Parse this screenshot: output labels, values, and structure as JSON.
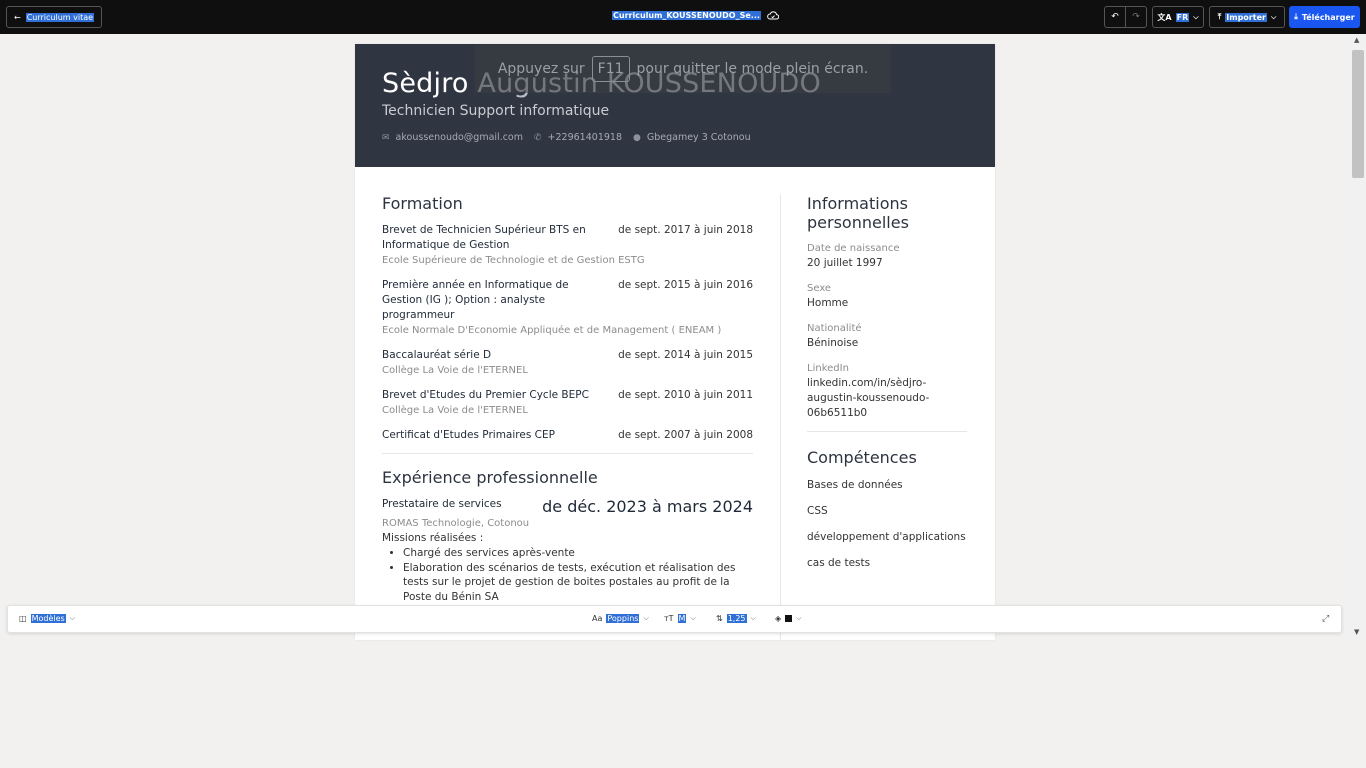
{
  "topbar": {
    "back_label": "Curriculum vitae",
    "doc_title": "Curriculum_KOUSSENOUDO_Se...",
    "undo_icon": "undo-icon",
    "redo_icon": "redo-icon",
    "language": "FR",
    "import_label": "Importer",
    "download_label": "Télécharger",
    "accent_color": "#1a56f0"
  },
  "overlay": {
    "before": "Appuyez sur",
    "key": "F11",
    "after": "pour quitter le mode plein écran."
  },
  "cv": {
    "first_name": "Sèdjro",
    "last_name": "Augustin KOUSSENOUDO",
    "role": "Technicien Support informatique",
    "email": "akoussenoudo@gmail.com",
    "phone": "+22961401918",
    "address": "Gbegamey 3 Cotonou",
    "header_color": "#2f3541",
    "education_title": "Formation",
    "education": [
      {
        "degree": "Brevet de Technicien Supérieur BTS en Informatique de Gestion",
        "school": "Ecole Supérieure de Technologie et de Gestion ESTG",
        "dates": "de sept. 2017 à juin 2018"
      },
      {
        "degree": "Première année en Informatique de Gestion (IG ); Option : analyste programmeur",
        "school": "Ecole Normale D'Economie Appliquée et de Management ( ENEAM )",
        "dates": "de sept. 2015 à juin 2016"
      },
      {
        "degree": "Baccalauréat série D",
        "school": "Collège La Voie de l'ETERNEL",
        "dates": "de sept. 2014 à juin 2015"
      },
      {
        "degree": "Brevet d'Etudes du Premier Cycle BEPC",
        "school": "Collège La Voie de l'ETERNEL",
        "dates": "de sept. 2010 à juin 2011"
      },
      {
        "degree": "Certificat d'Etudes Primaires CEP",
        "school": "",
        "dates": "de sept. 2007 à juin 2008"
      }
    ],
    "experience_title": "Expérience professionnelle",
    "experience": [
      {
        "job": "Prestataire de services",
        "company": "ROMAS Technologie, Cotonou",
        "dates": "de déc. 2023 à mars 2024",
        "missions_label": "Missions réalisées :",
        "missions": [
          "Chargé des services après-vente",
          "Elaboration des scénarios de tests, exécution et réalisation des tests sur le projet de gestion de boites postales au profit de la Poste du Bénin SA"
        ]
      }
    ],
    "personal_title": "Informations personnelles",
    "personal": [
      {
        "key": "Date de naissance",
        "value": "20 juillet 1997"
      },
      {
        "key": "Sexe",
        "value": "Homme"
      },
      {
        "key": "Nationalité",
        "value": "Béninoise"
      },
      {
        "key": "LinkedIn",
        "value": "linkedin.com/in/sèdjro-augustin-koussenoudo-06b6511b0"
      }
    ],
    "skills_title": "Compétences",
    "skills": [
      "Bases de données",
      "CSS",
      "développement d'applications",
      "cas de tests"
    ]
  },
  "bottombar": {
    "models_label": "Modèles",
    "font_label": "Poppins",
    "size_label": "M",
    "line_height_label": "1,25",
    "color_swatch": "#111111"
  }
}
